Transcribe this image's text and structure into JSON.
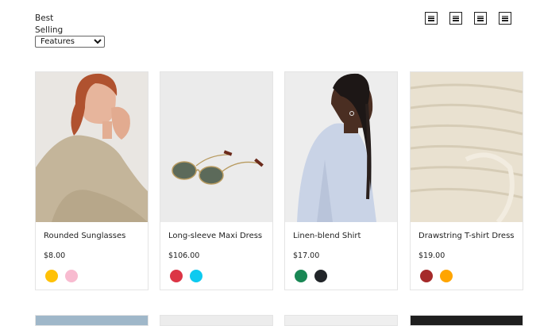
{
  "sort": {
    "label": "Best Selling",
    "selected": "Features"
  },
  "view_toggles": [
    {
      "name": "view-toggle-1"
    },
    {
      "name": "view-toggle-2"
    },
    {
      "name": "view-toggle-3"
    },
    {
      "name": "view-toggle-4"
    }
  ],
  "products": [
    {
      "name": "Rounded Sunglasses",
      "price": "$8.00",
      "swatches": [
        "#ffc107",
        "#f8bbd0"
      ]
    },
    {
      "name": "Long-sleeve Maxi Dress",
      "price": "$106.00",
      "swatches": [
        "#dc3545",
        "#0dcaf0"
      ]
    },
    {
      "name": "Linen-blend Shirt",
      "price": "$17.00",
      "swatches": [
        "#198754",
        "#212529"
      ]
    },
    {
      "name": "Drawstring T-shirt Dress",
      "price": "$19.00",
      "swatches": [
        "#a52a2a",
        "#ffa500"
      ]
    }
  ]
}
